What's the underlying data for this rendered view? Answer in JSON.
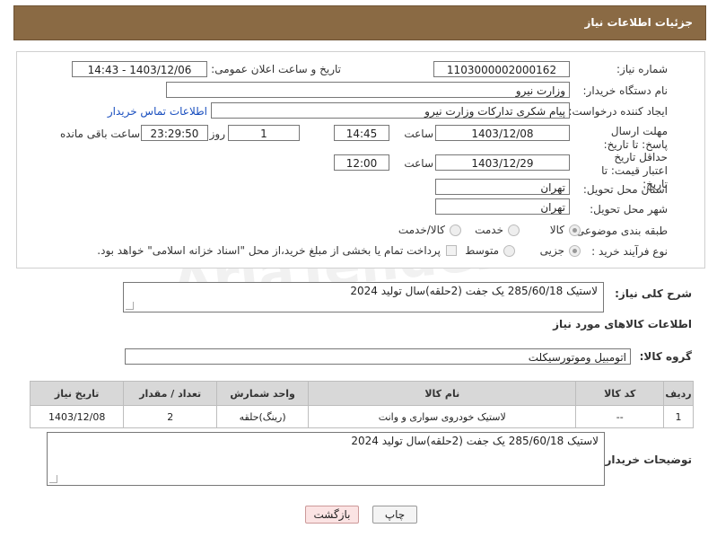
{
  "header": {
    "title": "جزئیات اطلاعات نیاز"
  },
  "form": {
    "need_number": {
      "label": "شماره نیاز:",
      "value": "1103000002000162"
    },
    "announce_datetime": {
      "label": "تاریخ و ساعت اعلان عمومی:",
      "value": "1403/12/06 - 14:43"
    },
    "buyer_org": {
      "label": "نام دستگاه خریدار:",
      "value": "وزارت نیرو"
    },
    "requester": {
      "label": "ایجاد کننده درخواست:",
      "value": "پیام شکری تدارکات وزارت نیرو",
      "contact_link": "اطلاعات تماس خریدار"
    },
    "reply_deadline": {
      "label": "مهلت ارسال پاسخ: تا تاریخ:",
      "date": "1403/12/08",
      "time_label": "ساعت",
      "time": "14:45",
      "days": "1",
      "days_label": "روز و",
      "remaining": "23:29:50",
      "remaining_label": "ساعت باقی مانده"
    },
    "price_validity": {
      "label": "حداقل تاریخ اعتبار قیمت: تا تاریخ:",
      "date": "1403/12/29",
      "time_label": "ساعت",
      "time": "12:00"
    },
    "province": {
      "label": "استان محل تحویل:",
      "value": "تهران"
    },
    "city": {
      "label": "شهر محل تحویل:",
      "value": "تهران"
    },
    "category": {
      "label": "طبقه بندی موضوعی:",
      "options": [
        "کالا",
        "خدمت",
        "کالا/خدمت"
      ],
      "selected": "کالا"
    },
    "process_type": {
      "label": "نوع فرآیند خرید :",
      "options": [
        "جزیی",
        "متوسط"
      ],
      "selected": "جزیی",
      "payment_note": "پرداخت تمام یا بخشی از مبلغ خرید،از محل \"اسناد خزانه اسلامی\" خواهد بود."
    }
  },
  "summary": {
    "label": "شرح کلی نیاز:",
    "value": "لاستیک 285/60/18 یک جفت (2حلقه)سال تولید 2024"
  },
  "goods_info": {
    "title": "اطلاعات کالاهای مورد نیاز",
    "group_label": "گروه کالا:",
    "group_value": "اتومبیل وموتورسیکلت"
  },
  "table": {
    "headers": [
      "ردیف",
      "کد کالا",
      "نام کالا",
      "واحد شمارش",
      "تعداد / مقدار",
      "تاریخ نیاز"
    ],
    "rows": [
      [
        "1",
        "--",
        "لاستیک خودروی سواری و وانت",
        "(رینگ)حلقه",
        "2",
        "1403/12/08"
      ]
    ]
  },
  "buyer_notes": {
    "label": "توضیحات خریدار:",
    "value": "لاستیک 285/60/18 یک جفت (2حلقه)سال تولید 2024"
  },
  "buttons": {
    "print": "چاپ",
    "back": "بازگشت"
  },
  "watermark": "AriaTender.neT"
}
